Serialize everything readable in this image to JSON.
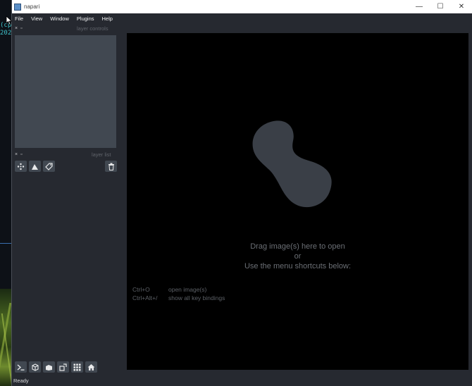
{
  "desktop": {
    "terminal_lines": [
      "(cp",
      "202"
    ]
  },
  "window": {
    "title": "napari",
    "controls": {
      "minimize": "—",
      "maximize": "☐",
      "close": "✕"
    }
  },
  "menu": {
    "items": [
      "File",
      "View",
      "Window",
      "Plugins",
      "Help"
    ]
  },
  "layer_controls": {
    "title": "layer controls",
    "close_glyph": "×",
    "float_glyph": "▫"
  },
  "layer_list": {
    "title": "layer list",
    "close_glyph": "×",
    "float_glyph": "▫",
    "buttons": [
      "new-points-icon",
      "new-shapes-icon",
      "new-labels-icon"
    ],
    "delete_icon": "trash-icon"
  },
  "bottom_toolbar": {
    "buttons": [
      "console-icon",
      "ndisplay-3d-icon",
      "roll-dims-icon",
      "transpose-icon",
      "grid-icon",
      "home-icon"
    ]
  },
  "canvas": {
    "welcome_line1": "Drag image(s) here to open",
    "welcome_line2": "or",
    "welcome_line3": "Use the menu shortcuts below:",
    "shortcuts": [
      {
        "key": "Ctrl+O",
        "action": "open image(s)"
      },
      {
        "key": "Ctrl+Alt+/",
        "action": "show all key bindings"
      }
    ]
  },
  "status": {
    "text": "Ready"
  },
  "colors": {
    "background": "#262930",
    "panel": "#414851",
    "canvas": "#000000",
    "blob": "#3a3f47"
  }
}
